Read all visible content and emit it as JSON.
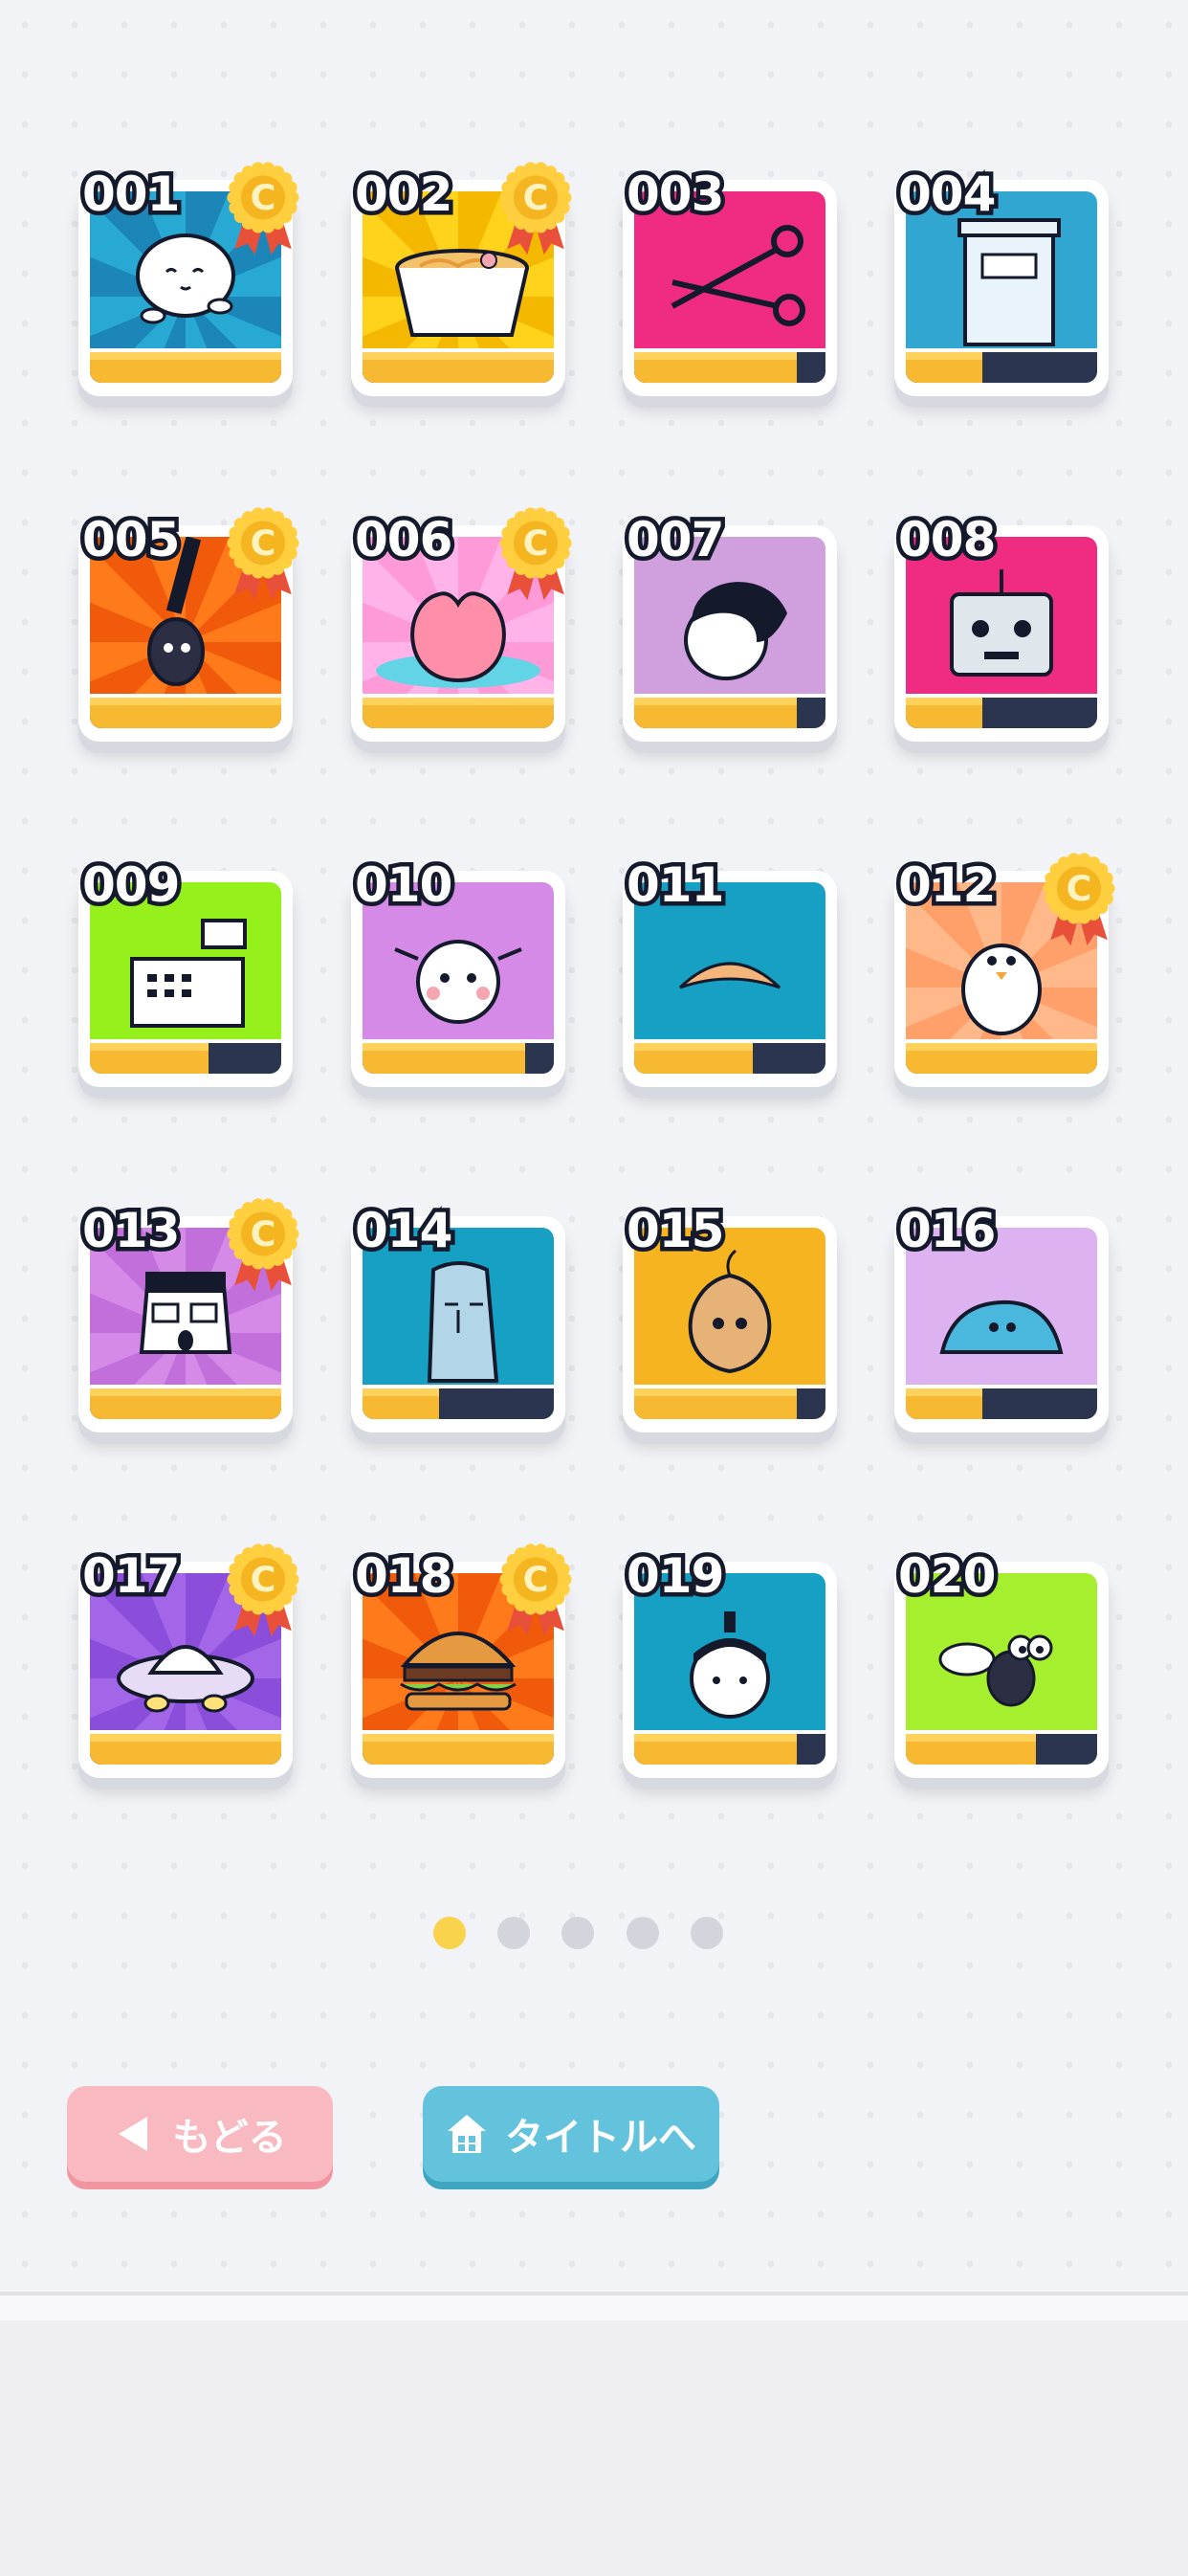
{
  "tiles": [
    {
      "number": "001",
      "icon": "round-ghost-icon",
      "bg": "#27a9d3",
      "bg2": "#1c86b8",
      "progress": 1.0,
      "medal": true
    },
    {
      "number": "002",
      "icon": "ramen-cup-icon",
      "bg": "#ffd21c",
      "bg2": "#f4b800",
      "progress": 1.0,
      "medal": true
    },
    {
      "number": "003",
      "icon": "scissors-icon",
      "bg": "#ef2b82",
      "bg2": "#ef2b82",
      "progress": 0.85,
      "medal": false
    },
    {
      "number": "004",
      "icon": "trash-bin-icon",
      "bg": "#30a6d1",
      "bg2": "#30a6d1",
      "progress": 0.4,
      "medal": false
    },
    {
      "number": "005",
      "icon": "microphone-icon",
      "bg": "#ff7a1a",
      "bg2": "#f05a0a",
      "progress": 1.0,
      "medal": true
    },
    {
      "number": "006",
      "icon": "peach-icon",
      "bg": "#ffb3e9",
      "bg2": "#ff9ad9",
      "progress": 1.0,
      "medal": true
    },
    {
      "number": "007",
      "icon": "pompadour-man-icon",
      "bg": "#cf9fde",
      "bg2": "#cf9fde",
      "progress": 0.85,
      "medal": false
    },
    {
      "number": "008",
      "icon": "robot-head-icon",
      "bg": "#ef2b82",
      "bg2": "#ef2b82",
      "progress": 0.4,
      "medal": false
    },
    {
      "number": "009",
      "icon": "cash-register-icon",
      "bg": "#96f01c",
      "bg2": "#96f01c",
      "progress": 0.62,
      "medal": false
    },
    {
      "number": "010",
      "icon": "pigtail-girl-icon",
      "bg": "#d48ae6",
      "bg2": "#d48ae6",
      "progress": 0.85,
      "medal": false
    },
    {
      "number": "011",
      "icon": "mountain-eyebrow-icon",
      "bg": "#15a0c4",
      "bg2": "#15a0c4",
      "progress": 0.62,
      "medal": false
    },
    {
      "number": "012",
      "icon": "white-bird-icon",
      "bg": "#ffb88a",
      "bg2": "#ffa06a",
      "progress": 1.0,
      "medal": true
    },
    {
      "number": "013",
      "icon": "shocked-man-icon",
      "bg": "#d48ae6",
      "bg2": "#c26fdc",
      "progress": 1.0,
      "medal": true
    },
    {
      "number": "014",
      "icon": "moai-icon",
      "bg": "#15a0c4",
      "bg2": "#15a0c4",
      "progress": 0.4,
      "medal": false
    },
    {
      "number": "015",
      "icon": "onion-icon",
      "bg": "#f7b421",
      "bg2": "#f7b421",
      "progress": 0.85,
      "medal": false
    },
    {
      "number": "016",
      "icon": "blue-blob-icon",
      "bg": "#ddb2f0",
      "bg2": "#ddb2f0",
      "progress": 0.4,
      "medal": false
    },
    {
      "number": "017",
      "icon": "ufo-icon",
      "bg": "#a366e8",
      "bg2": "#8a4edb",
      "progress": 1.0,
      "medal": true
    },
    {
      "number": "018",
      "icon": "hamburger-icon",
      "bg": "#ff7a1a",
      "bg2": "#f05a0a",
      "progress": 1.0,
      "medal": true
    },
    {
      "number": "019",
      "icon": "topknot-man-icon",
      "bg": "#15a0c4",
      "bg2": "#15a0c4",
      "progress": 0.85,
      "medal": false
    },
    {
      "number": "020",
      "icon": "fly-icon",
      "bg": "#a6ef2e",
      "bg2": "#a6ef2e",
      "progress": 0.68,
      "medal": false
    }
  ],
  "pagination": {
    "total": 5,
    "current": 1
  },
  "buttons": {
    "back": {
      "label": "もどる",
      "icon": "left-triangle-icon"
    },
    "title": {
      "label": "タイトルへ",
      "icon": "house-icon"
    }
  },
  "medal": {
    "letter": "C"
  },
  "colors": {
    "gold": "#f7b931",
    "medal": "#ffcf3f",
    "ribbon": "#e8503a",
    "outline": "#14192b",
    "dot_active": "#f8d34b",
    "dot_inactive": "#d2d5dc"
  }
}
